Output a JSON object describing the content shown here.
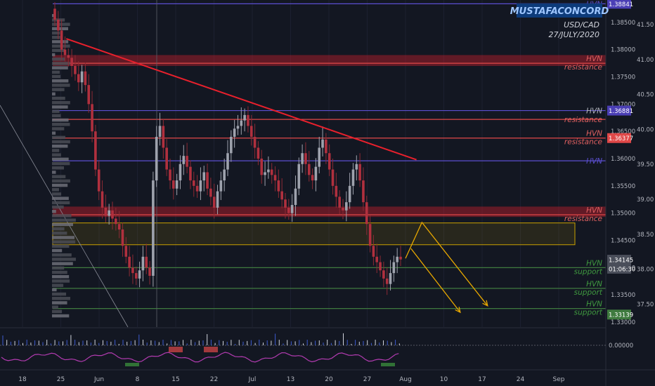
{
  "chart_data": {
    "type": "candlestick",
    "symbol": "USD/CAD",
    "date_label": "27/JULY/2020",
    "author": "MUSTAFACONCORD",
    "y_primary": {
      "ticks": [
        "1.38500",
        "1.38000",
        "1.37500",
        "1.37000",
        "1.36500",
        "1.36000",
        "1.35500",
        "1.35000",
        "1.34500",
        "1.34000",
        "1.33500",
        "1.33000"
      ],
      "range": [
        1.3291,
        1.3891
      ]
    },
    "y_secondary": {
      "ticks": [
        "41.50",
        "41.00",
        "40.50",
        "40.00",
        "39.50",
        "39.00",
        "38.50",
        "38.00",
        "37.50"
      ]
    },
    "x_ticks": [
      "18",
      "25",
      "Jun",
      "8",
      "15",
      "22",
      "Jul",
      "13",
      "20",
      "27",
      "Aug",
      "10",
      "17",
      "24",
      "Sep"
    ],
    "price_badges": [
      {
        "label": "1.38841",
        "price": 1.38841,
        "color": "#4b3fb5"
      },
      {
        "label": "1.36881",
        "price": 1.36881,
        "color": "#4b3fb5"
      },
      {
        "label": "1.36377",
        "price": 1.36377,
        "color": "#e04848"
      },
      {
        "label": "1.34145",
        "price": 1.34145,
        "color": "#4a4e5a"
      },
      {
        "label": "01:06:30",
        "price": 1.3398,
        "color": "#4a4e5a"
      },
      {
        "label": "1.33139",
        "price": 1.33139,
        "color": "#3f7a3f"
      }
    ],
    "levels": [
      {
        "price": 1.38841,
        "color": "#5b4fd0",
        "labels": [
          "HVN"
        ],
        "label_color": "#5b4fd0"
      },
      {
        "price": 1.3775,
        "color": "#e04848",
        "labels": [
          "HVN",
          "resistance"
        ],
        "label_color": "#e06060"
      },
      {
        "price": 1.36881,
        "color": "#5b4fd0",
        "labels": [
          "HVN"
        ],
        "label_color": "#b2b5be"
      },
      {
        "price": 1.3672,
        "color": "#e04848",
        "labels": [
          "resistance"
        ],
        "label_color": "#e06060"
      },
      {
        "price": 1.36377,
        "color": "#e04848",
        "labels": [
          "HVN",
          "resistance"
        ],
        "label_color": "#e06060"
      },
      {
        "price": 1.3596,
        "color": "#5b4fd0",
        "labels": [
          "HVN"
        ],
        "label_color": "#5b4fd0"
      },
      {
        "price": 1.3497,
        "color": "#e04848",
        "labels": [
          "HVN",
          "resistance"
        ],
        "label_color": "#e06060"
      },
      {
        "price": 1.34,
        "color": "#3f7a3f",
        "labels": [
          "HVN",
          "support"
        ],
        "label_color": "#3f9a3f"
      },
      {
        "price": 1.3362,
        "color": "#3f7a3f",
        "labels": [
          "HVN",
          "support"
        ],
        "label_color": "#3f9a3f"
      },
      {
        "price": 1.3325,
        "color": "#3f7a3f",
        "labels": [
          "HVN",
          "support"
        ],
        "label_color": "#3f9a3f"
      }
    ],
    "zones": [
      {
        "from": 1.377,
        "to": 1.379,
        "color": "#c0202c"
      },
      {
        "from": 1.3493,
        "to": 1.3512,
        "color": "#c0202c"
      },
      {
        "from": 1.3442,
        "to": 1.3482,
        "color": "#c9a000"
      }
    ],
    "trendline": {
      "from": {
        "date": "2020-05-26",
        "price": 1.382
      },
      "to": {
        "date": "2020-07-29",
        "price": 1.3598
      }
    },
    "projection": [
      {
        "date": "2020-07-27",
        "price": 1.3417
      },
      {
        "date": "2020-07-30",
        "price": 1.3483
      },
      {
        "date": "2020-08-11",
        "price": 1.333
      }
    ],
    "projection_2": [
      {
        "date": "2020-07-28",
        "price": 1.3435
      },
      {
        "date": "2020-08-06",
        "price": 1.3318
      }
    ],
    "closes": [
      1.3855,
      1.3835,
      1.38,
      1.379,
      1.3785,
      1.377,
      1.3755,
      1.374,
      1.376,
      1.3735,
      1.37,
      1.365,
      1.358,
      1.354,
      1.351,
      1.3495,
      1.3505,
      1.349,
      1.348,
      1.347,
      1.344,
      1.342,
      1.34,
      1.339,
      1.338,
      1.3395,
      1.342,
      1.34,
      1.3385,
      1.356,
      1.364,
      1.366,
      1.362,
      1.358,
      1.356,
      1.3545,
      1.356,
      1.359,
      1.3605,
      1.3585,
      1.356,
      1.355,
      1.354,
      1.356,
      1.3575,
      1.3545,
      1.353,
      1.351,
      1.354,
      1.356,
      1.358,
      1.361,
      1.364,
      1.3655,
      1.366,
      1.367,
      1.368,
      1.366,
      1.364,
      1.362,
      1.36,
      1.357,
      1.3575,
      1.358,
      1.357,
      1.356,
      1.354,
      1.3525,
      1.351,
      1.35,
      1.3515,
      1.3545,
      1.359,
      1.361,
      1.359,
      1.357,
      1.356,
      1.3585,
      1.362,
      1.3635,
      1.361,
      1.358,
      1.355,
      1.353,
      1.351,
      1.3505,
      1.352,
      1.355,
      1.358,
      1.359,
      1.356,
      1.352,
      1.348,
      1.344,
      1.342,
      1.341,
      1.3395,
      1.338,
      1.337,
      1.339,
      1.341,
      1.342,
      1.3415
    ]
  }
}
